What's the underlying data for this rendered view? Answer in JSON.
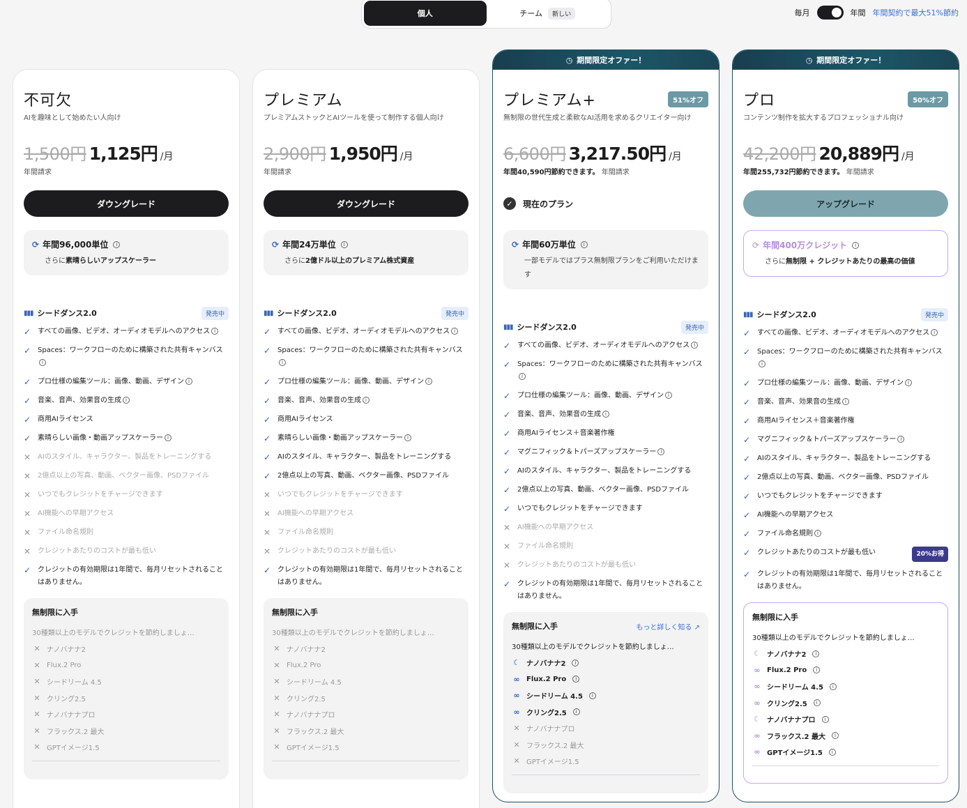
{
  "toggle": {
    "individual": "個人",
    "team": "チーム",
    "team_badge": "新しい"
  },
  "billing": {
    "monthly": "毎月",
    "yearly": "年間",
    "save_note": "年間契約で最大51%節約"
  },
  "plans": [
    {
      "name": "不可欠",
      "tagline": "AIを趣味として始めたい人向け",
      "old_price": "1,500円",
      "price": "1,125円",
      "per": "/月",
      "savings": "",
      "billing_note": "年間請求",
      "button": "ダウングレード",
      "credits_title": "年間96,000単位",
      "credits_desc_pre": "さらに",
      "credits_desc_bold": "素晴らしいアップスケーラー",
      "seedance": "シードダンス2.0",
      "seedance_badge": "発売中",
      "features": [
        {
          "text": "すべての画像、ビデオ、オーディオモデルへのアクセス",
          "on": true,
          "info": true
        },
        {
          "text": "Spaces：ワークフローのために構築された共有キャンバス",
          "on": true,
          "info": true
        },
        {
          "text": "プロ仕様の編集ツール：画像、動画、デザイン",
          "on": true,
          "info": true
        },
        {
          "text": "音楽、音声、効果音の生成",
          "on": true,
          "info": true
        },
        {
          "text": "商用AIライセンス",
          "on": true,
          "info": false
        },
        {
          "text": "素晴らしい画像・動画アップスケーラー",
          "on": true,
          "info": true
        },
        {
          "text": "AIのスタイル、キャラクター、製品をトレーニングする",
          "on": false,
          "info": false
        },
        {
          "text": "2億点以上の写真、動画、ベクター画像、PSDファイル",
          "on": false,
          "info": false
        },
        {
          "text": "いつでもクレジットをチャージできます",
          "on": false,
          "info": false
        },
        {
          "text": "AI機能への早期アクセス",
          "on": false,
          "info": false
        },
        {
          "text": "ファイル命名規則",
          "on": false,
          "info": false
        },
        {
          "text": "クレジットあたりのコストが最も低い",
          "on": false,
          "info": false
        },
        {
          "text": "クレジットの有効期限は1年間で、毎月リセットされることはありません。",
          "on": true,
          "info": false
        }
      ],
      "unlimited": {
        "title": "無制限に入手",
        "more": "",
        "desc": "30種類以上のモデルでクレジットを節約しましょ…",
        "models": [
          {
            "name": "ナノバナナ2",
            "on": false
          },
          {
            "name": "Flux.2 Pro",
            "on": false
          },
          {
            "name": "シードリーム 4.5",
            "on": false
          },
          {
            "name": "クリング2.5",
            "on": false
          },
          {
            "name": "ナノバナナプロ",
            "on": false
          },
          {
            "name": "フラックス.2 最大",
            "on": false
          },
          {
            "name": "GPTイメージ1.5",
            "on": false
          }
        ]
      }
    },
    {
      "name": "プレミアム",
      "tagline": "プレミアムストックとAIツールを使って制作する個人向け",
      "old_price": "2,900円",
      "price": "1,950円",
      "per": "/月",
      "savings": "",
      "billing_note": "年間請求",
      "button": "ダウングレード",
      "credits_title": "年間24万単位",
      "credits_desc_pre": "さらに",
      "credits_desc_bold": "2億ドル以上のプレミアム株式資産",
      "seedance": "シードダンス2.0",
      "seedance_badge": "発売中",
      "features": [
        {
          "text": "すべての画像、ビデオ、オーディオモデルへのアクセス",
          "on": true,
          "info": true
        },
        {
          "text": "Spaces：ワークフローのために構築された共有キャンバス",
          "on": true,
          "info": true
        },
        {
          "text": "プロ仕様の編集ツール：画像、動画、デザイン",
          "on": true,
          "info": true
        },
        {
          "text": "音楽、音声、効果音の生成",
          "on": true,
          "info": true
        },
        {
          "text": "商用AIライセンス",
          "on": true,
          "info": false
        },
        {
          "text": "素晴らしい画像・動画アップスケーラー",
          "on": true,
          "info": true
        },
        {
          "text": "AIのスタイル、キャラクター、製品をトレーニングする",
          "on": true,
          "info": false
        },
        {
          "text": "2億点以上の写真、動画、ベクター画像、PSDファイル",
          "on": true,
          "info": false
        },
        {
          "text": "いつでもクレジットをチャージできます",
          "on": false,
          "info": false
        },
        {
          "text": "AI機能への早期アクセス",
          "on": false,
          "info": false
        },
        {
          "text": "ファイル命名規則",
          "on": false,
          "info": false
        },
        {
          "text": "クレジットあたりのコストが最も低い",
          "on": false,
          "info": false
        },
        {
          "text": "クレジットの有効期限は1年間で、毎月リセットされることはありません。",
          "on": true,
          "info": false
        }
      ],
      "unlimited": {
        "title": "無制限に入手",
        "more": "",
        "desc": "30種類以上のモデルでクレジットを節約しましょ…",
        "models": [
          {
            "name": "ナノバナナ2",
            "on": false
          },
          {
            "name": "Flux.2 Pro",
            "on": false
          },
          {
            "name": "シードリーム 4.5",
            "on": false
          },
          {
            "name": "クリング2.5",
            "on": false
          },
          {
            "name": "ナノバナナプロ",
            "on": false
          },
          {
            "name": "フラックス.2 最大",
            "on": false
          },
          {
            "name": "GPTイメージ1.5",
            "on": false
          }
        ]
      }
    },
    {
      "banner": "期間限定オファー！",
      "name": "プレミアム+",
      "offer": "51%オフ",
      "tagline": "無制限の世代生成と柔軟なAI活用を求めるクリエイター向け",
      "old_price": "6,600円",
      "price": "3,217.50円",
      "per": "/月",
      "savings": "年間40,590円節約できます。",
      "billing_note": "年間請求",
      "current": "現在のプラン",
      "credits_title": "年間60万単位",
      "credits_desc_pre": "一部モデルではプラス無制限プランをご利用いただけます",
      "credits_desc_bold": "",
      "seedance": "シードダンス2.0",
      "seedance_badge": "発売中",
      "features": [
        {
          "text": "すべての画像、ビデオ、オーディオモデルへのアクセス",
          "on": true,
          "info": true
        },
        {
          "text": "Spaces：ワークフローのために構築された共有キャンバス",
          "on": true,
          "info": true
        },
        {
          "text": "プロ仕様の編集ツール：画像、動画、デザイン",
          "on": true,
          "info": true
        },
        {
          "text": "音楽、音声、効果音の生成",
          "on": true,
          "info": true
        },
        {
          "text": "商用AIライセンス＋音楽著作権",
          "on": true,
          "info": false
        },
        {
          "text": "マグニフィック＆トパーズアップスケーラー",
          "on": true,
          "info": true
        },
        {
          "text": "AIのスタイル、キャラクター、製品をトレーニングする",
          "on": true,
          "info": false
        },
        {
          "text": "2億点以上の写真、動画、ベクター画像、PSDファイル",
          "on": true,
          "info": false
        },
        {
          "text": "いつでもクレジットをチャージできます",
          "on": true,
          "info": false
        },
        {
          "text": "AI機能への早期アクセス",
          "on": false,
          "info": false
        },
        {
          "text": "ファイル命名規則",
          "on": false,
          "info": false
        },
        {
          "text": "クレジットあたりのコストが最も低い",
          "on": false,
          "info": false
        },
        {
          "text": "クレジットの有効期限は1年間で、毎月リセットされることはありません。",
          "on": true,
          "info": false
        }
      ],
      "unlimited": {
        "title": "無制限に入手",
        "more": "もっと詳しく知る ↗",
        "desc": "30種類以上のモデルでクレジットを節約しましょ…",
        "models": [
          {
            "name": "ナノバナナ2",
            "on": true
          },
          {
            "name": "Flux.2 Pro",
            "on": true
          },
          {
            "name": "シードリーム 4.5",
            "on": true
          },
          {
            "name": "クリング2.5",
            "on": true
          },
          {
            "name": "ナノバナナプロ",
            "on": false
          },
          {
            "name": "フラックス.2 最大",
            "on": false
          },
          {
            "name": "GPTイメージ1.5",
            "on": false
          }
        ]
      }
    },
    {
      "banner": "期間限定オファー！",
      "name": "プロ",
      "offer": "50%オフ",
      "tagline": "コンテンツ制作を拡大するプロフェッショナル向け",
      "old_price": "42,200円",
      "price": "20,889円",
      "per": "/月",
      "savings": "年間255,732円節約できます。",
      "billing_note": "年間請求",
      "button": "アップグレード",
      "credits_title": "年間400万クレジット",
      "credits_desc_pre": "さらに",
      "credits_desc_bold": "無制限 + クレジットあたりの最高の価値",
      "seedance": "シードダンス2.0",
      "seedance_badge": "発売中",
      "features": [
        {
          "text": "すべての画像、ビデオ、オーディオモデルへのアクセス",
          "on": true,
          "info": true
        },
        {
          "text": "Spaces：ワークフローのために構築された共有キャンバス",
          "on": true,
          "info": true
        },
        {
          "text": "プロ仕様の編集ツール：画像、動画、デザイン",
          "on": true,
          "info": true
        },
        {
          "text": "音楽、音声、効果音の生成",
          "on": true,
          "info": true
        },
        {
          "text": "商用AIライセンス＋音楽著作権",
          "on": true,
          "info": false
        },
        {
          "text": "マグニフィック＆トパーズアップスケーラー",
          "on": true,
          "info": true
        },
        {
          "text": "AIのスタイル、キャラクター、製品をトレーニングする",
          "on": true,
          "info": false
        },
        {
          "text": "2億点以上の写真、動画、ベクター画像、PSDファイル",
          "on": true,
          "info": false
        },
        {
          "text": "いつでもクレジットをチャージできます",
          "on": true,
          "info": false
        },
        {
          "text": "AI機能への早期アクセス",
          "on": true,
          "info": false
        },
        {
          "text": "ファイル命名規則",
          "on": true,
          "info": true
        },
        {
          "text": "クレジットあたりのコストが最も低い",
          "on": true,
          "info": false,
          "badge": "20%お得"
        },
        {
          "text": "クレジットの有効期限は1年間で、毎月リセットされることはありません。",
          "on": true,
          "info": false
        }
      ],
      "unlimited": {
        "title": "無制限に入手",
        "more": "",
        "desc": "30種類以上のモデルでクレジットを節約しましょ…",
        "models": [
          {
            "name": "ナノバナナ2",
            "on": true
          },
          {
            "name": "Flux.2 Pro",
            "on": true
          },
          {
            "name": "シードリーム 4.5",
            "on": true
          },
          {
            "name": "クリング2.5",
            "on": true
          },
          {
            "name": "ナノバナナプロ",
            "on": true
          },
          {
            "name": "フラックス.2 最大",
            "on": true
          },
          {
            "name": "GPTイメージ1.5",
            "on": true
          }
        ]
      }
    }
  ]
}
